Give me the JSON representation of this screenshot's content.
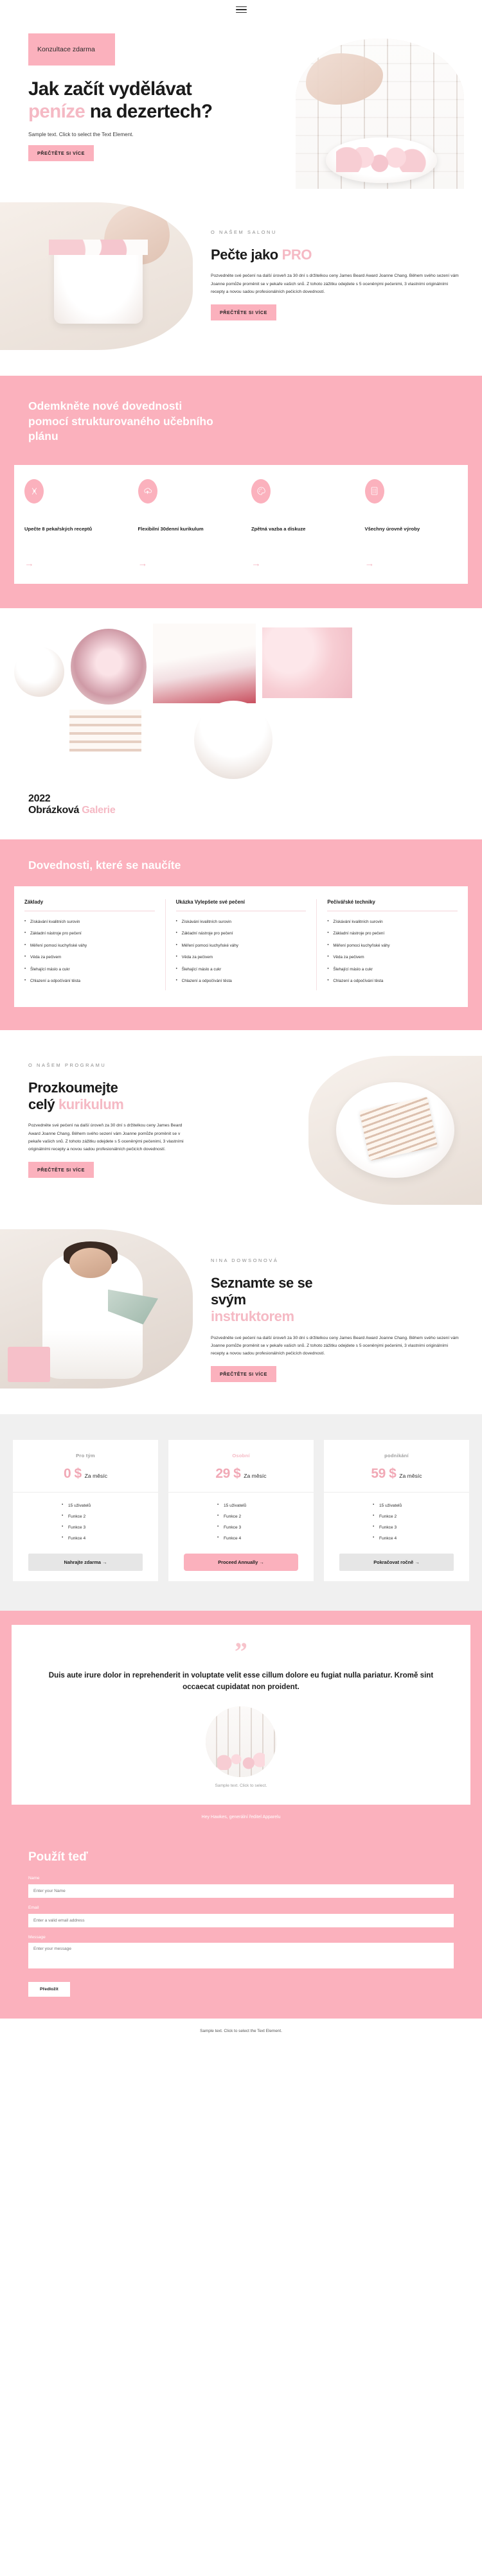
{
  "theme": {
    "pink": "#fbb1bd",
    "pink_light": "#f5b9c4",
    "grey_band": "#f0f0f0",
    "dark": "#1a1a1a"
  },
  "topbar": {
    "menu_icon": "hamburger-menu-icon"
  },
  "hero": {
    "badge": "Konzultace zdarma",
    "title_line1": "Jak začít vydělávat",
    "title_accent": "peníze",
    "title_line2_rest": " na",
    "title_line3": "dezertech?",
    "sample_text": "Sample text. Click to select the Text Element.",
    "button": "PŘEČTĚTE SI VÍCE"
  },
  "about": {
    "eyebrow": "O NAŠEM SALONU",
    "title_main": "Pečte jako ",
    "title_accent": "PRO",
    "body": "Pozvedněte své pečení na další úroveň za 30 dní s držitelkou ceny James Beard Award Joanne Chang. Během svého sezení vám Joanne pomůže proměnit se v pekaře vašich snů. Z tohoto zážitku odejdete s 5 oceněnými pečenimi, 3 vlastními originálními recepty a novou sadou profesionálních pečicích dovedností.",
    "button": "PŘEČTĚTE SI VÍCE"
  },
  "skills_band": {
    "title": "Odemkněte nové dovednosti pomocí strukturovaného učebního plánu",
    "cards": [
      {
        "icon": "whisk-icon",
        "title": "Upečte 8 pekařských receptů",
        "arrow": "→"
      },
      {
        "icon": "cupcake-upload-icon",
        "title": "Flexibilní 30denní kurikulum",
        "arrow": "→"
      },
      {
        "icon": "palette-icon",
        "title": "Zpětná vazba a diskuze",
        "arrow": "→"
      },
      {
        "icon": "checklist-icon",
        "title": "Všechny úrovně výroby",
        "arrow": "→"
      }
    ]
  },
  "gallery": {
    "year": "2022",
    "title_main": "Obrázková ",
    "title_accent": "Galerie",
    "images": [
      {
        "name": "photo-meringue-plate"
      },
      {
        "name": "photo-rose-cake"
      },
      {
        "name": "photo-berry-cake"
      },
      {
        "name": "photo-pink-meringues"
      },
      {
        "name": "photo-layer-cake"
      },
      {
        "name": "photo-white-cake"
      }
    ]
  },
  "skills_table": {
    "title": "Dovednosti, které se naučíte",
    "columns": [
      {
        "header": "Základy",
        "items": [
          "Získávání kvalitních surovin",
          "Základní nástroje pro pečení",
          "Měření pomoci kuchyňské váhy",
          "Věda za pečivem",
          "Šlehající máslo a cukr",
          "Chlazení a odpočívání těsta"
        ]
      },
      {
        "header": "Ukázka Vylepšete své pečení",
        "items": [
          "Získávání kvalitních surovin",
          "Základní nástroje pro pečení",
          "Měření pomoci kuchyňské váhy",
          "Věda za pečivem",
          "Šlehající máslo a cukr",
          "Chlazení a odpočívání těsta"
        ]
      },
      {
        "header": "Pečivářské techniky",
        "items": [
          "Získávání kvalitních surovin",
          "Základní nástroje pro pečení",
          "Měření pomoci kuchyňské váhy",
          "Věda za pečivem",
          "Šlehající máslo a cukr",
          "Chlazení a odpočívání těsta"
        ]
      }
    ]
  },
  "program": {
    "eyebrow": "O NAŠEM PROGRAMU",
    "title_line1": "Prozkoumejte",
    "title_line2_main": "celý ",
    "title_accent": "kurikulum",
    "body": "Pozvedněte své pečení na další úroveň za 30 dní s držitelkou ceny James Beard Award Joanne Chang. Během svého sezení vám Joanne pomůže proměnit se v pekaře vašich snů. Z tohoto zážitku odejdete s 5 oceněnými pečenimi, 3 vlastními originálními recepty a novou sadou profesionálních pečicích dovedností.",
    "button": "PŘEČTĚTE SI VÍCE"
  },
  "instructor": {
    "eyebrow": "NINA DOWSONOVÁ",
    "title_line1": "Seznamte se se",
    "title_line2": "svým",
    "title_accent": "instruktorem",
    "body": "Pozvedněte své pečení na další úroveň za 30 dní s držitelkou ceny James Beard Award Joanne Chang. Během svého sezení vám Joanne pomůže proměnit se v pekaře vašich snů. Z tohoto zážitku odejdete s 5 oceněnými pečenimi, 3 vlastními originálními recepty a novou sadou profesionálních pečicích dovedností.",
    "button": "PŘEČTĚTE SI VÍCE"
  },
  "pricing": {
    "plans": [
      {
        "name": "Pro tým",
        "name_style": "grey",
        "price": "0 $",
        "period": "Za měsíc",
        "features": [
          "15 uživatelů",
          "Funkce 2",
          "Funkce 3",
          "Funkce 4"
        ],
        "button": "Nahrajte zdarma →",
        "button_style": "plain"
      },
      {
        "name": "Osobní",
        "name_style": "pink",
        "price": "29 $",
        "period": "Za měsíc",
        "features": [
          "15 uživatelů",
          "Funkce 2",
          "Funkce 3",
          "Funkce 4"
        ],
        "button": "Proceed Annually →",
        "button_style": "hot"
      },
      {
        "name": "podnikání",
        "name_style": "grey",
        "price": "59 $",
        "period": "Za měsíc",
        "features": [
          "15 uživatelů",
          "Funkce 2",
          "Funkce 3",
          "Funkce 4"
        ],
        "button": "Pokračovat ročně →",
        "button_style": "plain"
      }
    ]
  },
  "testimonial": {
    "quote_mark": "”",
    "text": "Duis aute irure dolor in reprehenderit in voluptate velit esse cillum dolore eu fugiat nulla pariatur. Kromě sint occaecat cupidatat non proident.",
    "avatar_name": "avatar-photo",
    "author": "Sample text. Click to select.",
    "footnote": "Hey Hawkes, generální ředitel Apparelu"
  },
  "contact": {
    "title": "Použít teď",
    "fields": [
      {
        "label": "Name",
        "placeholder": "Enter your Name",
        "value": ""
      },
      {
        "label": "Email",
        "placeholder": "Enter a valid email address",
        "value": ""
      },
      {
        "label": "Message",
        "placeholder": "Enter your message",
        "value": ""
      }
    ],
    "submit": "Předložit"
  },
  "footer": {
    "text": "Sample text. Click to select the Text Element."
  }
}
